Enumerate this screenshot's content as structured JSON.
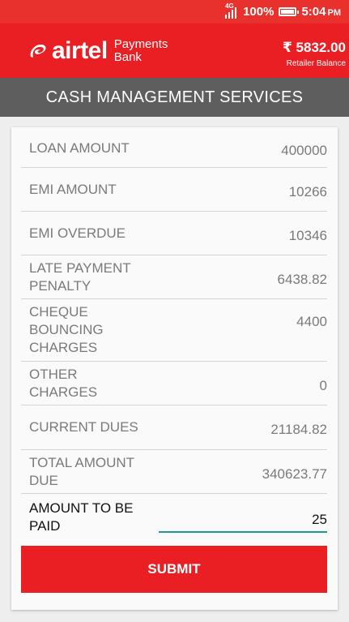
{
  "status_bar": {
    "network": "4G",
    "battery": "100%",
    "time": "5:04",
    "ampm": "PM"
  },
  "header": {
    "logo_word": "airtel",
    "logo_line1": "Payments",
    "logo_line2": "Bank",
    "balance_amount": "₹ 5832.00",
    "balance_label": "Retailer Balance"
  },
  "title": "CASH MANAGEMENT SERVICES",
  "rows": [
    {
      "label": "LOAN AMOUNT",
      "value": "400000"
    },
    {
      "label": "EMI AMOUNT",
      "value": "10266"
    },
    {
      "label": "EMI OVERDUE",
      "value": "10346"
    },
    {
      "label": "LATE PAYMENT PENALTY",
      "value": "6438.82"
    },
    {
      "label": "CHEQUE BOUNCING CHARGES",
      "value": "4400"
    },
    {
      "label": "OTHER CHARGES",
      "value": "0"
    },
    {
      "label": "CURRENT DUES",
      "value": "21184.82"
    },
    {
      "label": "TOTAL AMOUNT DUE",
      "value": "340623.77"
    }
  ],
  "amount_to_pay": {
    "label": "AMOUNT TO BE PAID",
    "value": "25"
  },
  "submit_label": "SUBMIT",
  "colors": {
    "brand_red": "#ea1f24",
    "title_gray": "#5e5e5e",
    "input_accent": "#1e9a8c"
  }
}
